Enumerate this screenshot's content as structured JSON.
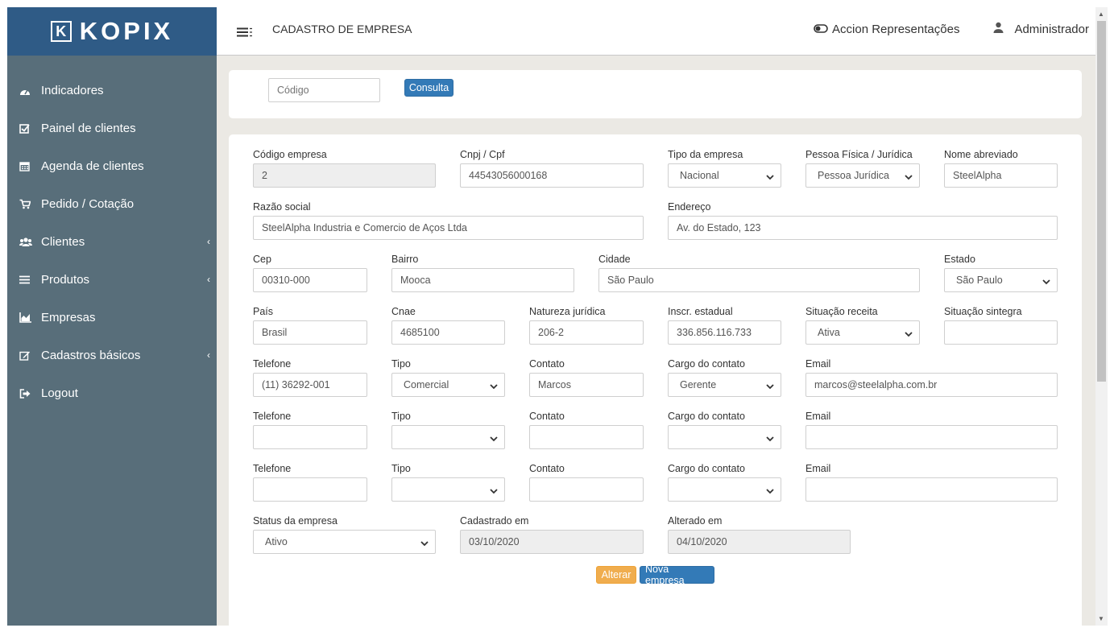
{
  "brand": {
    "logo_letter": "K",
    "name": "KOPIX"
  },
  "sidebar": {
    "items": [
      {
        "label": "Indicadores",
        "icon": "dashboard-icon"
      },
      {
        "label": "Painel de clientes",
        "icon": "check-square-icon"
      },
      {
        "label": "Agenda de clientes",
        "icon": "calendar-icon"
      },
      {
        "label": "Pedido / Cotação",
        "icon": "cart-icon"
      },
      {
        "label": "Clientes",
        "icon": "users-icon",
        "has_submenu": true
      },
      {
        "label": "Produtos",
        "icon": "list-icon",
        "has_submenu": true
      },
      {
        "label": "Empresas",
        "icon": "chart-icon"
      },
      {
        "label": "Cadastros básicos",
        "icon": "edit-icon",
        "has_submenu": true
      },
      {
        "label": "Logout",
        "icon": "sign-out-icon"
      }
    ]
  },
  "header": {
    "title": "CADASTRO DE EMPRESA",
    "company": "Accion Representações",
    "user": "Administrador"
  },
  "search": {
    "placeholder": "Código",
    "button": "Consulta"
  },
  "form": {
    "codigo_empresa": {
      "label": "Código empresa",
      "value": "2"
    },
    "cnpj": {
      "label": "Cnpj / Cpf",
      "value": "44543056000168"
    },
    "tipo_empresa": {
      "label": "Tipo da empresa",
      "value": "Nacional"
    },
    "pessoa": {
      "label": "Pessoa Física / Jurídica",
      "value": "Pessoa Jurídica"
    },
    "nome_abreviado": {
      "label": "Nome abreviado",
      "value": "SteelAlpha"
    },
    "razao_social": {
      "label": "Razão social",
      "value": "SteelAlpha Industria e Comercio de Aços Ltda"
    },
    "endereco": {
      "label": "Endereço",
      "value": "Av. do Estado, 123"
    },
    "cep": {
      "label": "Cep",
      "value": "00310-000"
    },
    "bairro": {
      "label": "Bairro",
      "value": "Mooca"
    },
    "cidade": {
      "label": "Cidade",
      "value": "São Paulo"
    },
    "estado": {
      "label": "Estado",
      "value": "São Paulo"
    },
    "pais": {
      "label": "País",
      "value": "Brasil"
    },
    "cnae": {
      "label": "Cnae",
      "value": "4685100"
    },
    "natureza": {
      "label": "Natureza jurídica",
      "value": "206-2"
    },
    "inscr": {
      "label": "Inscr. estadual",
      "value": "336.856.116.733"
    },
    "situacao_receita": {
      "label": "Situação receita",
      "value": "Ativa"
    },
    "situacao_sintegra": {
      "label": "Situação sintegra",
      "value": ""
    },
    "contacts": [
      {
        "telefone": "(11) 36292-001",
        "tipo": "Comercial",
        "contato": "Marcos",
        "cargo": "Gerente",
        "email": "marcos@steelalpha.com.br"
      },
      {
        "telefone": "",
        "tipo": "",
        "contato": "",
        "cargo": "",
        "email": ""
      },
      {
        "telefone": "",
        "tipo": "",
        "contato": "",
        "cargo": "",
        "email": ""
      }
    ],
    "contact_labels": {
      "telefone": "Telefone",
      "tipo": "Tipo",
      "contato": "Contato",
      "cargo": "Cargo do contato",
      "email": "Email"
    },
    "status": {
      "label": "Status da empresa",
      "value": "Ativo"
    },
    "cadastrado": {
      "label": "Cadastrado em",
      "value": "03/10/2020"
    },
    "alterado": {
      "label": "Alterado em",
      "value": "04/10/2020"
    }
  },
  "actions": {
    "alterar": "Alterar",
    "nova": "Nova empresa"
  }
}
